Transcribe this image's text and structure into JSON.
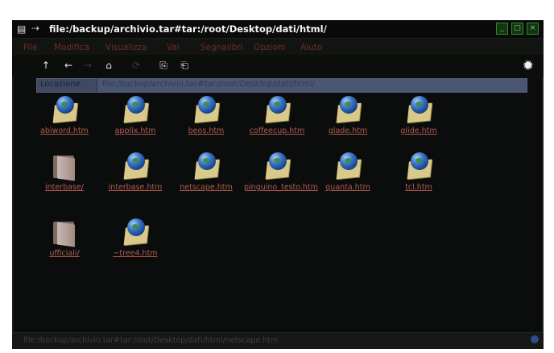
{
  "window": {
    "title": "file:/backup/archivio.tar#tar:/root/Desktop/dati/html/",
    "buttons": [
      "_",
      "□",
      "×"
    ]
  },
  "menubar": {
    "items": [
      "File",
      "Modifica",
      "Visualizza",
      "Vai",
      "Segnalibri",
      "Opzioni",
      "Aiuto"
    ]
  },
  "toolbar": {
    "up": "↑",
    "back": "←",
    "forward": "→",
    "home": "⌂",
    "reload": "⟳",
    "copy": "⎘",
    "paste": "⎗",
    "settings": "✹"
  },
  "location": {
    "label": "Locazione",
    "value": "file:/backup/archivio.tar#tar:/root/Desktop/dati/html/"
  },
  "files": [
    {
      "name": "abiword.htm",
      "kind": "html"
    },
    {
      "name": "applix.htm",
      "kind": "html"
    },
    {
      "name": "beos.htm",
      "kind": "html"
    },
    {
      "name": "coffeecup.htm",
      "kind": "html"
    },
    {
      "name": "glade.htm",
      "kind": "html"
    },
    {
      "name": "glide.htm",
      "kind": "html"
    },
    {
      "name": "interbase/",
      "kind": "folder"
    },
    {
      "name": "interbase.htm",
      "kind": "html"
    },
    {
      "name": "netscape.htm",
      "kind": "html"
    },
    {
      "name": "pinguino_testo.htm",
      "kind": "html"
    },
    {
      "name": "quanta.htm",
      "kind": "html"
    },
    {
      "name": "tcl.htm",
      "kind": "html"
    },
    {
      "name": "ufficiali/",
      "kind": "folder"
    },
    {
      "name": "~tree4.htm",
      "kind": "html"
    }
  ],
  "statusbar": {
    "text": "file:/backup/archivio.tar#tar:/root/Desktop/dati/html/netscape.htm"
  }
}
